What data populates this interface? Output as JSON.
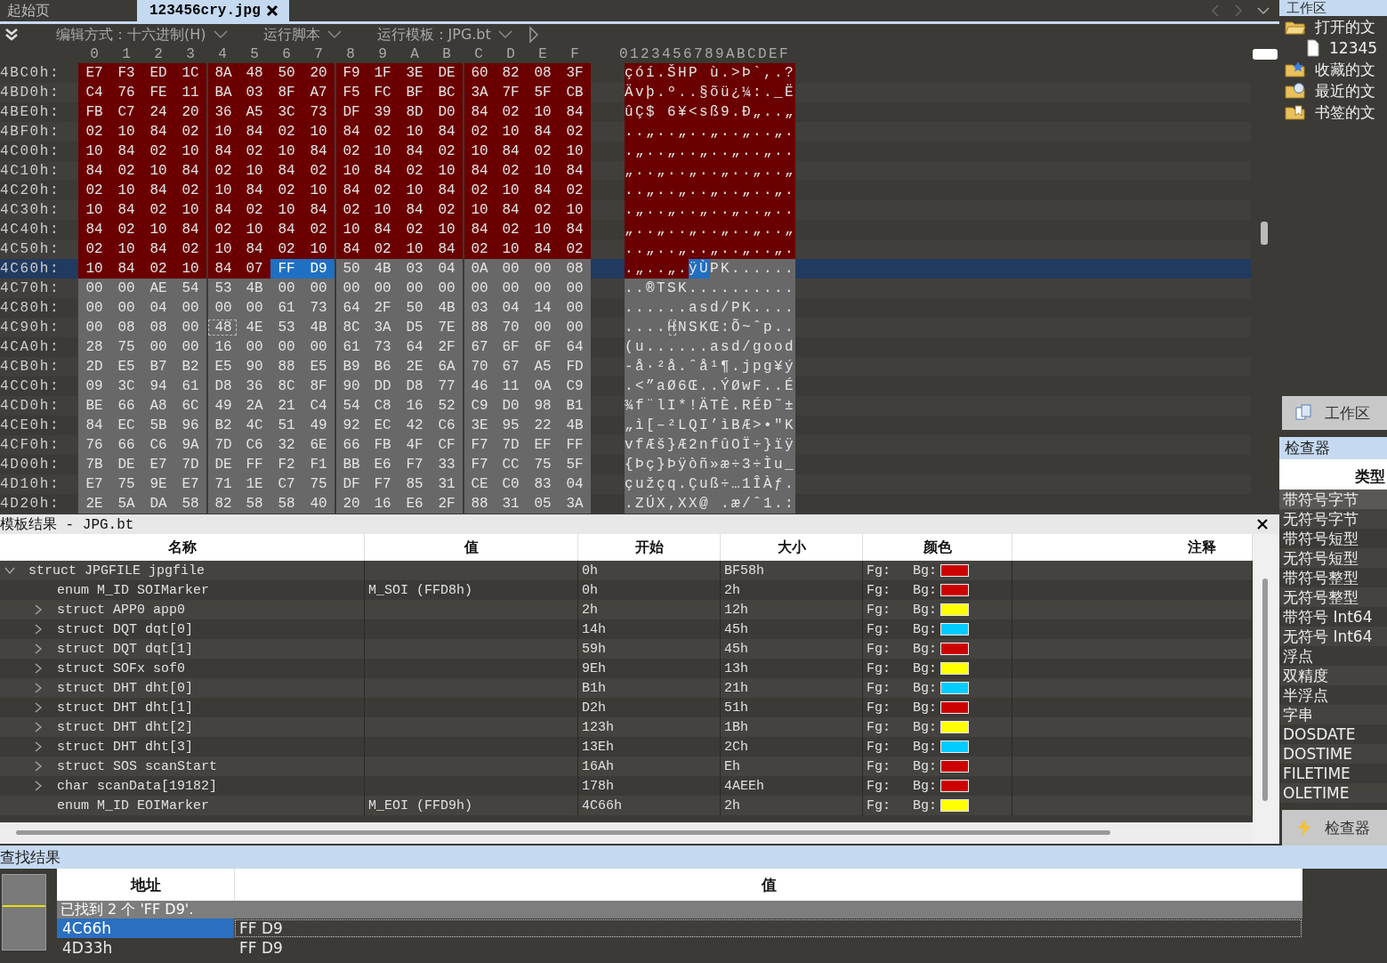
{
  "tabs": [
    {
      "label": "起始页",
      "selected": false,
      "closable": false
    },
    {
      "label": "123456cry.jpg",
      "selected": true,
      "closable": true
    }
  ],
  "toolbar": {
    "edit_mode": "编辑方式：十六进制(H)",
    "run_script": "运行脚本",
    "run_template": "运行模板：JPG.bt"
  },
  "hex_view": {
    "column_headers": [
      "0",
      "1",
      "2",
      "3",
      "4",
      "5",
      "6",
      "7",
      "8",
      "9",
      "A",
      "B",
      "C",
      "D",
      "E",
      "F"
    ],
    "ascii_header": "0123456789ABCDEF",
    "rows": [
      {
        "address": "4BC0h:",
        "current": false,
        "bytes": [
          {
            "kind": "marked",
            "text": "E7 F3 ED 1C 8A 48 50 20 F9 1F 3E DE 60 82 08 3F"
          }
        ],
        "ascii": [
          {
            "kind": "marked",
            "text": "çóí.ŠHP ù.>Þ`,.?"
          }
        ]
      },
      {
        "address": "4BD0h:",
        "current": false,
        "bytes": [
          {
            "kind": "marked",
            "text": "C4 76 FE 11 BA 03 8F A7 F5 FC BF BC 3A 7F 5F CB"
          }
        ],
        "ascii": [
          {
            "kind": "marked",
            "text": "Ävþ.º..§õü¿¼:._Ë"
          }
        ]
      },
      {
        "address": "4BE0h:",
        "current": false,
        "bytes": [
          {
            "kind": "marked",
            "text": "FB C7 24 20 36 A5 3C 73 DF 39 8D D0 84 02 10 84"
          }
        ],
        "ascii": [
          {
            "kind": "marked",
            "text": "ûÇ$ 6¥<sß9.Ð„..„"
          }
        ]
      },
      {
        "address": "4BF0h:",
        "current": false,
        "bytes": [
          {
            "kind": "marked",
            "text": "02 10 84 02 10 84 02 10 84 02 10 84 02 10 84 02"
          }
        ],
        "ascii": [
          {
            "kind": "marked",
            "text": "..„..„..„..„..„."
          }
        ]
      },
      {
        "address": "4C00h:",
        "current": false,
        "bytes": [
          {
            "kind": "marked",
            "text": "10 84 02 10 84 02 10 84 02 10 84 02 10 84 02 10"
          }
        ],
        "ascii": [
          {
            "kind": "marked",
            "text": ".„..„..„..„..„.."
          }
        ]
      },
      {
        "address": "4C10h:",
        "current": false,
        "bytes": [
          {
            "kind": "marked",
            "text": "84 02 10 84 02 10 84 02 10 84 02 10 84 02 10 84"
          }
        ],
        "ascii": [
          {
            "kind": "marked",
            "text": "„..„..„..„..„..„"
          }
        ]
      },
      {
        "address": "4C20h:",
        "current": false,
        "bytes": [
          {
            "kind": "marked",
            "text": "02 10 84 02 10 84 02 10 84 02 10 84 02 10 84 02"
          }
        ],
        "ascii": [
          {
            "kind": "marked",
            "text": "..„..„..„..„..„."
          }
        ]
      },
      {
        "address": "4C30h:",
        "current": false,
        "bytes": [
          {
            "kind": "marked",
            "text": "10 84 02 10 84 02 10 84 02 10 84 02 10 84 02 10"
          }
        ],
        "ascii": [
          {
            "kind": "marked",
            "text": ".„..„..„..„..„.."
          }
        ]
      },
      {
        "address": "4C40h:",
        "current": false,
        "bytes": [
          {
            "kind": "marked",
            "text": "84 02 10 84 02 10 84 02 10 84 02 10 84 02 10 84"
          }
        ],
        "ascii": [
          {
            "kind": "marked",
            "text": "„..„..„..„..„..„"
          }
        ]
      },
      {
        "address": "4C50h:",
        "current": false,
        "bytes": [
          {
            "kind": "marked",
            "text": "02 10 84 02 10 84 02 10 84 02 10 84 02 10 84 02"
          }
        ],
        "ascii": [
          {
            "kind": "marked",
            "text": "..„..„..„..„..„."
          }
        ]
      },
      {
        "address": "4C60h:",
        "current": true,
        "bytes": [
          {
            "kind": "marked",
            "text": "10 84 02 10 84 07"
          },
          {
            "kind": "selected",
            "text": "FF D9"
          },
          {
            "kind": "plain",
            "text": "50 4B 03 04 0A 00 00 08"
          }
        ],
        "ascii": [
          {
            "kind": "marked",
            "text": ".„..„."
          },
          {
            "kind": "selected",
            "text": "ÿÙ"
          },
          {
            "kind": "plain",
            "text": "PK......"
          }
        ]
      },
      {
        "address": "4C70h:",
        "current": false,
        "bytes": [
          {
            "kind": "plain",
            "text": "00 00 AE 54 53 4B 00 00 00 00 00 00 00 00 00 00"
          }
        ],
        "ascii": [
          {
            "kind": "plain",
            "text": "..®TSK.........."
          }
        ]
      },
      {
        "address": "4C80h:",
        "current": false,
        "bytes": [
          {
            "kind": "plain",
            "text": "00 00 04 00 00 00 61 73 64 2F 50 4B 03 04 14 00"
          }
        ],
        "ascii": [
          {
            "kind": "plain",
            "text": "......asd/PK...."
          }
        ]
      },
      {
        "address": "4C90h:",
        "current": false,
        "bytes": [
          {
            "kind": "plain",
            "text": "00 08 08 00"
          },
          {
            "kind": "cursor",
            "text": "48"
          },
          {
            "kind": "plain",
            "text": "4E 53 4B 8C 3A D5 7E 88 70 00 00"
          }
        ],
        "ascii": [
          {
            "kind": "plain",
            "text": "...."
          },
          {
            "kind": "cursor",
            "text": "H"
          },
          {
            "kind": "plain",
            "text": "NSKŒ:Õ~ˆp.."
          }
        ]
      },
      {
        "address": "4CA0h:",
        "current": false,
        "bytes": [
          {
            "kind": "plain",
            "text": "28 75 00 00 16 00 00 00 61 73 64 2F 67 6F 6F 64"
          }
        ],
        "ascii": [
          {
            "kind": "plain",
            "text": "(u......asd/good"
          }
        ]
      },
      {
        "address": "4CB0h:",
        "current": false,
        "bytes": [
          {
            "kind": "plain",
            "text": "2D E5 B7 B2 E5 90 88 E5 B9 B6 2E 6A 70 67 A5 FD"
          }
        ],
        "ascii": [
          {
            "kind": "plain",
            "text": "-å·²å.ˆå¹¶.jpg¥ý"
          }
        ]
      },
      {
        "address": "4CC0h:",
        "current": false,
        "bytes": [
          {
            "kind": "plain",
            "text": "09 3C 94 61 D8 36 8C 8F 90 DD D8 77 46 11 0A C9"
          }
        ],
        "ascii": [
          {
            "kind": "plain",
            "text": ".<”aØ6Œ..ÝØwF..É"
          }
        ]
      },
      {
        "address": "4CD0h:",
        "current": false,
        "bytes": [
          {
            "kind": "plain",
            "text": "BE 66 A8 6C 49 2A 21 C4 54 C8 16 52 C9 D0 98 B1"
          }
        ],
        "ascii": [
          {
            "kind": "plain",
            "text": "¾f¨lI*!ÄTÈ.RÉÐ˜±"
          }
        ]
      },
      {
        "address": "4CE0h:",
        "current": false,
        "bytes": [
          {
            "kind": "plain",
            "text": "84 EC 5B 96 B2 4C 51 49 92 EC 42 C6 3E 95 22 4B"
          }
        ],
        "ascii": [
          {
            "kind": "plain",
            "text": "„ì[–²LQI’ìBÆ>•\"K"
          }
        ]
      },
      {
        "address": "4CF0h:",
        "current": false,
        "bytes": [
          {
            "kind": "plain",
            "text": "76 66 C6 9A 7D C6 32 6E 66 FB 4F CF F7 7D EF FF"
          }
        ],
        "ascii": [
          {
            "kind": "plain",
            "text": "vfÆš}Æ2nfûOÏ÷}ïÿ"
          }
        ]
      },
      {
        "address": "4D00h:",
        "current": false,
        "bytes": [
          {
            "kind": "plain",
            "text": "7B DE E7 7D DE FF F2 F1 BB E6 F7 33 F7 CC 75 5F"
          }
        ],
        "ascii": [
          {
            "kind": "plain",
            "text": "{Þç}Þÿòñ»æ÷3÷Ìu_"
          }
        ]
      },
      {
        "address": "4D10h:",
        "current": false,
        "bytes": [
          {
            "kind": "plain",
            "text": "E7 75 9E E7 71 1E C7 75 DF F7 85 31 CE C0 83 04"
          }
        ],
        "ascii": [
          {
            "kind": "plain",
            "text": "çužçq.Çuß÷…1ÎÀƒ."
          }
        ]
      },
      {
        "address": "4D20h:",
        "current": false,
        "bytes": [
          {
            "kind": "plain",
            "text": "2E 5A DA 58 82 58 58 40 20 16 E6 2F 88 31 05 3A"
          }
        ],
        "ascii": [
          {
            "kind": "plain",
            "text": ".ZÚX‚XX@ .æ/ˆ1.:"
          }
        ]
      }
    ]
  },
  "template_results": {
    "title": "模板结果 - JPG.bt",
    "columns": [
      "名称",
      "值",
      "开始",
      "大小",
      "颜色",
      "注释"
    ],
    "rows": [
      {
        "name": "struct JPGFILE jpgfile",
        "start": "0h",
        "size": "BF58h",
        "fg": "Fg:",
        "bg": "Bg:",
        "color": "#cc0000",
        "kind": "group",
        "expanded": true,
        "children": [
          {
            "name": "enum M_ID SOIMarker",
            "value": "M_SOI (FFD8h)",
            "start": "0h",
            "size": "2h",
            "fg": "Fg:",
            "bg": "Bg:",
            "color": "#cc0000",
            "kind": "field"
          },
          {
            "name": "struct APP0 app0",
            "start": "2h",
            "size": "12h",
            "fg": "Fg:",
            "bg": "Bg:",
            "color": "#ffff00",
            "kind": "group",
            "expanded": false
          },
          {
            "name": "struct DQT dqt[0]",
            "start": "14h",
            "size": "45h",
            "fg": "Fg:",
            "bg": "Bg:",
            "color": "#00ccff",
            "kind": "group",
            "expanded": false
          },
          {
            "name": "struct DQT dqt[1]",
            "start": "59h",
            "size": "45h",
            "fg": "Fg:",
            "bg": "Bg:",
            "color": "#cc0000",
            "kind": "group",
            "expanded": false
          },
          {
            "name": "struct SOFx sof0",
            "start": "9Eh",
            "size": "13h",
            "fg": "Fg:",
            "bg": "Bg:",
            "color": "#ffff00",
            "kind": "group",
            "expanded": false
          },
          {
            "name": "struct DHT dht[0]",
            "start": "B1h",
            "size": "21h",
            "fg": "Fg:",
            "bg": "Bg:",
            "color": "#00ccff",
            "kind": "group",
            "expanded": false
          },
          {
            "name": "struct DHT dht[1]",
            "start": "D2h",
            "size": "51h",
            "fg": "Fg:",
            "bg": "Bg:",
            "color": "#cc0000",
            "kind": "group",
            "expanded": false
          },
          {
            "name": "struct DHT dht[2]",
            "start": "123h",
            "size": "1Bh",
            "fg": "Fg:",
            "bg": "Bg:",
            "color": "#ffff00",
            "kind": "group",
            "expanded": false
          },
          {
            "name": "struct DHT dht[3]",
            "start": "13Eh",
            "size": "2Ch",
            "fg": "Fg:",
            "bg": "Bg:",
            "color": "#00ccff",
            "kind": "group",
            "expanded": false
          },
          {
            "name": "struct SOS scanStart",
            "start": "16Ah",
            "size": "Eh",
            "fg": "Fg:",
            "bg": "Bg:",
            "color": "#cc0000",
            "kind": "group",
            "expanded": false
          },
          {
            "name": "char scanData[19182]",
            "start": "178h",
            "size": "4AEEh",
            "fg": "Fg:",
            "bg": "Bg:",
            "color": "#cc0000",
            "kind": "group",
            "expanded": false
          },
          {
            "name": "enum M_ID EOIMarker",
            "value": "M_EOI (FFD9h)",
            "start": "4C66h",
            "size": "2h",
            "fg": "Fg:",
            "bg": "Bg:",
            "color": "#ffff00",
            "kind": "field"
          }
        ]
      }
    ]
  },
  "sidebar": {
    "workspace_title": "工作区",
    "tree": [
      {
        "label": "打开的文",
        "kind": "open",
        "children": [
          {
            "label": "12345",
            "kind": "file"
          }
        ]
      },
      {
        "label": "收藏的文",
        "kind": "favorites"
      },
      {
        "label": "最近的文",
        "kind": "recent"
      },
      {
        "label": "书签的文",
        "kind": "bookmarks"
      }
    ],
    "workspace_tab": "工作区",
    "inspector_title": "检查器",
    "inspector_column": "类型",
    "inspector_rows": [
      "带符号字节",
      "无符号字节",
      "带符号短型",
      "无符号短型",
      "带符号整型",
      "无符号整型",
      "带符号 Int64",
      "无符号 Int64",
      "浮点",
      "双精度",
      "半浮点",
      "字串",
      "DOSDATE",
      "DOSTIME",
      "FILETIME",
      "OLETIME"
    ],
    "inspector_tab": "检查器"
  },
  "find_results": {
    "title": "查找结果",
    "columns": [
      "地址",
      "值"
    ],
    "message": "已找到 2 个 'FF D9'.",
    "rows": [
      {
        "address": "4C66h",
        "value": "FF D9",
        "selected": true
      },
      {
        "address": "4D33h",
        "value": "FF D9",
        "selected": false
      }
    ]
  }
}
